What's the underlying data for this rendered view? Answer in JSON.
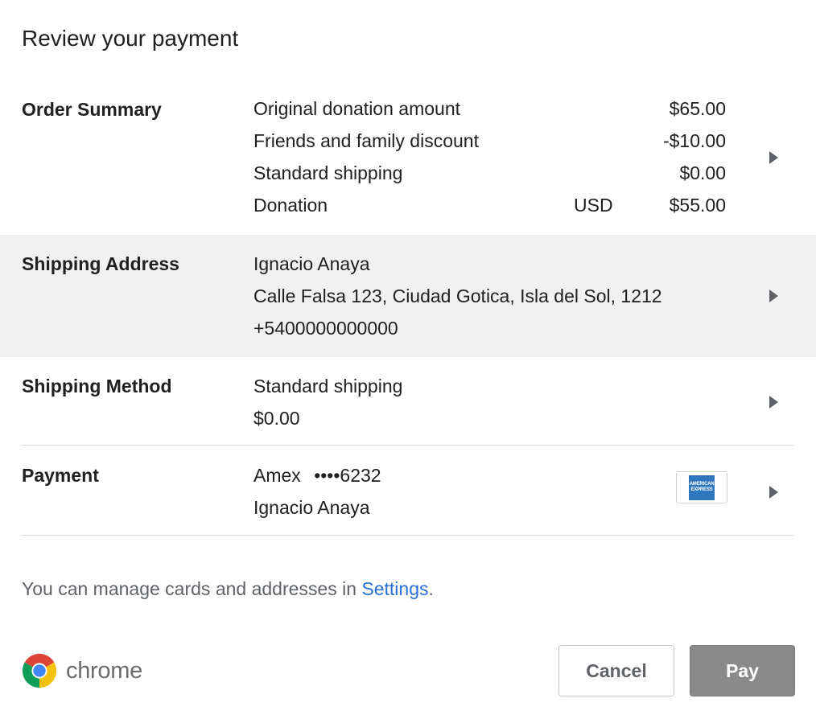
{
  "dialog": {
    "title": "Review your payment"
  },
  "order_summary": {
    "label": "Order Summary",
    "rows": [
      {
        "label": "Original donation amount",
        "currency": "",
        "amount": "$65.00"
      },
      {
        "label": "Friends and family discount",
        "currency": "",
        "amount": "-$10.00"
      },
      {
        "label": "Standard shipping",
        "currency": "",
        "amount": "$0.00"
      },
      {
        "label": "Donation",
        "currency": "USD",
        "amount": "$55.00"
      }
    ]
  },
  "shipping_address": {
    "label": "Shipping Address",
    "name": "Ignacio Anaya",
    "address": "Calle Falsa 123, Ciudad Gotica, Isla del Sol, 1212",
    "phone": "+5400000000000",
    "highlight_color": "#f1f1f1"
  },
  "shipping_method": {
    "label": "Shipping Method",
    "method": "Standard shipping",
    "price": "$0.00"
  },
  "payment": {
    "label": "Payment",
    "card_brand": "Amex",
    "card_mask": "••••6232",
    "cardholder": "Ignacio Anaya",
    "card_logo_lines": [
      "AMERICAN",
      "EXPRESS"
    ],
    "card_logo_color": "#2e77bc"
  },
  "footer": {
    "note_prefix": "You can manage cards and addresses in ",
    "settings_link": "Settings",
    "note_suffix": "."
  },
  "brand": {
    "name": "chrome",
    "icon": "chrome-logo-icon"
  },
  "buttons": {
    "cancel": "Cancel",
    "pay": "Pay"
  },
  "icons": {
    "chevron": "chevron-right-icon"
  },
  "colors": {
    "link": "#2b6fd6",
    "pay_button": "#8a8a8a",
    "divider": "#dadada"
  }
}
